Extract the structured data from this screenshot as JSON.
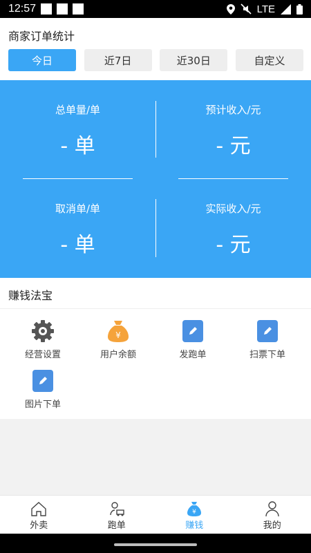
{
  "status_bar": {
    "time": "12:57",
    "network": "LTE"
  },
  "header": {
    "title": "商家订单统计",
    "tabs": [
      {
        "label": "今日",
        "active": true
      },
      {
        "label": "近7日",
        "active": false
      },
      {
        "label": "近30日",
        "active": false
      },
      {
        "label": "自定义",
        "active": false
      }
    ]
  },
  "stats": {
    "total_orders": {
      "label": "总单量/单",
      "value": "- 单"
    },
    "expected_income": {
      "label": "预计收入/元",
      "value": "- 元"
    },
    "cancelled_orders": {
      "label": "取消单/单",
      "value": "- 单"
    },
    "actual_income": {
      "label": "实际收入/元",
      "value": "- 元"
    }
  },
  "tools": {
    "title": "赚钱法宝",
    "items": [
      {
        "label": "经营设置",
        "icon": "gear-icon"
      },
      {
        "label": "用户余额",
        "icon": "money-bag-icon"
      },
      {
        "label": "发跑单",
        "icon": "edit-icon"
      },
      {
        "label": "扫票下单",
        "icon": "edit-icon"
      },
      {
        "label": "图片下单",
        "icon": "edit-icon"
      }
    ]
  },
  "bottom_nav": {
    "items": [
      {
        "label": "外卖",
        "icon": "home-icon",
        "active": false
      },
      {
        "label": "跑单",
        "icon": "courier-icon",
        "active": false
      },
      {
        "label": "赚钱",
        "icon": "money-bag-icon",
        "active": true
      },
      {
        "label": "我的",
        "icon": "user-icon",
        "active": false
      }
    ]
  },
  "colors": {
    "accent": "#3aa6f5",
    "edit_icon": "#4a90e2",
    "money_bag": "#f5a33b",
    "gear": "#555555"
  }
}
